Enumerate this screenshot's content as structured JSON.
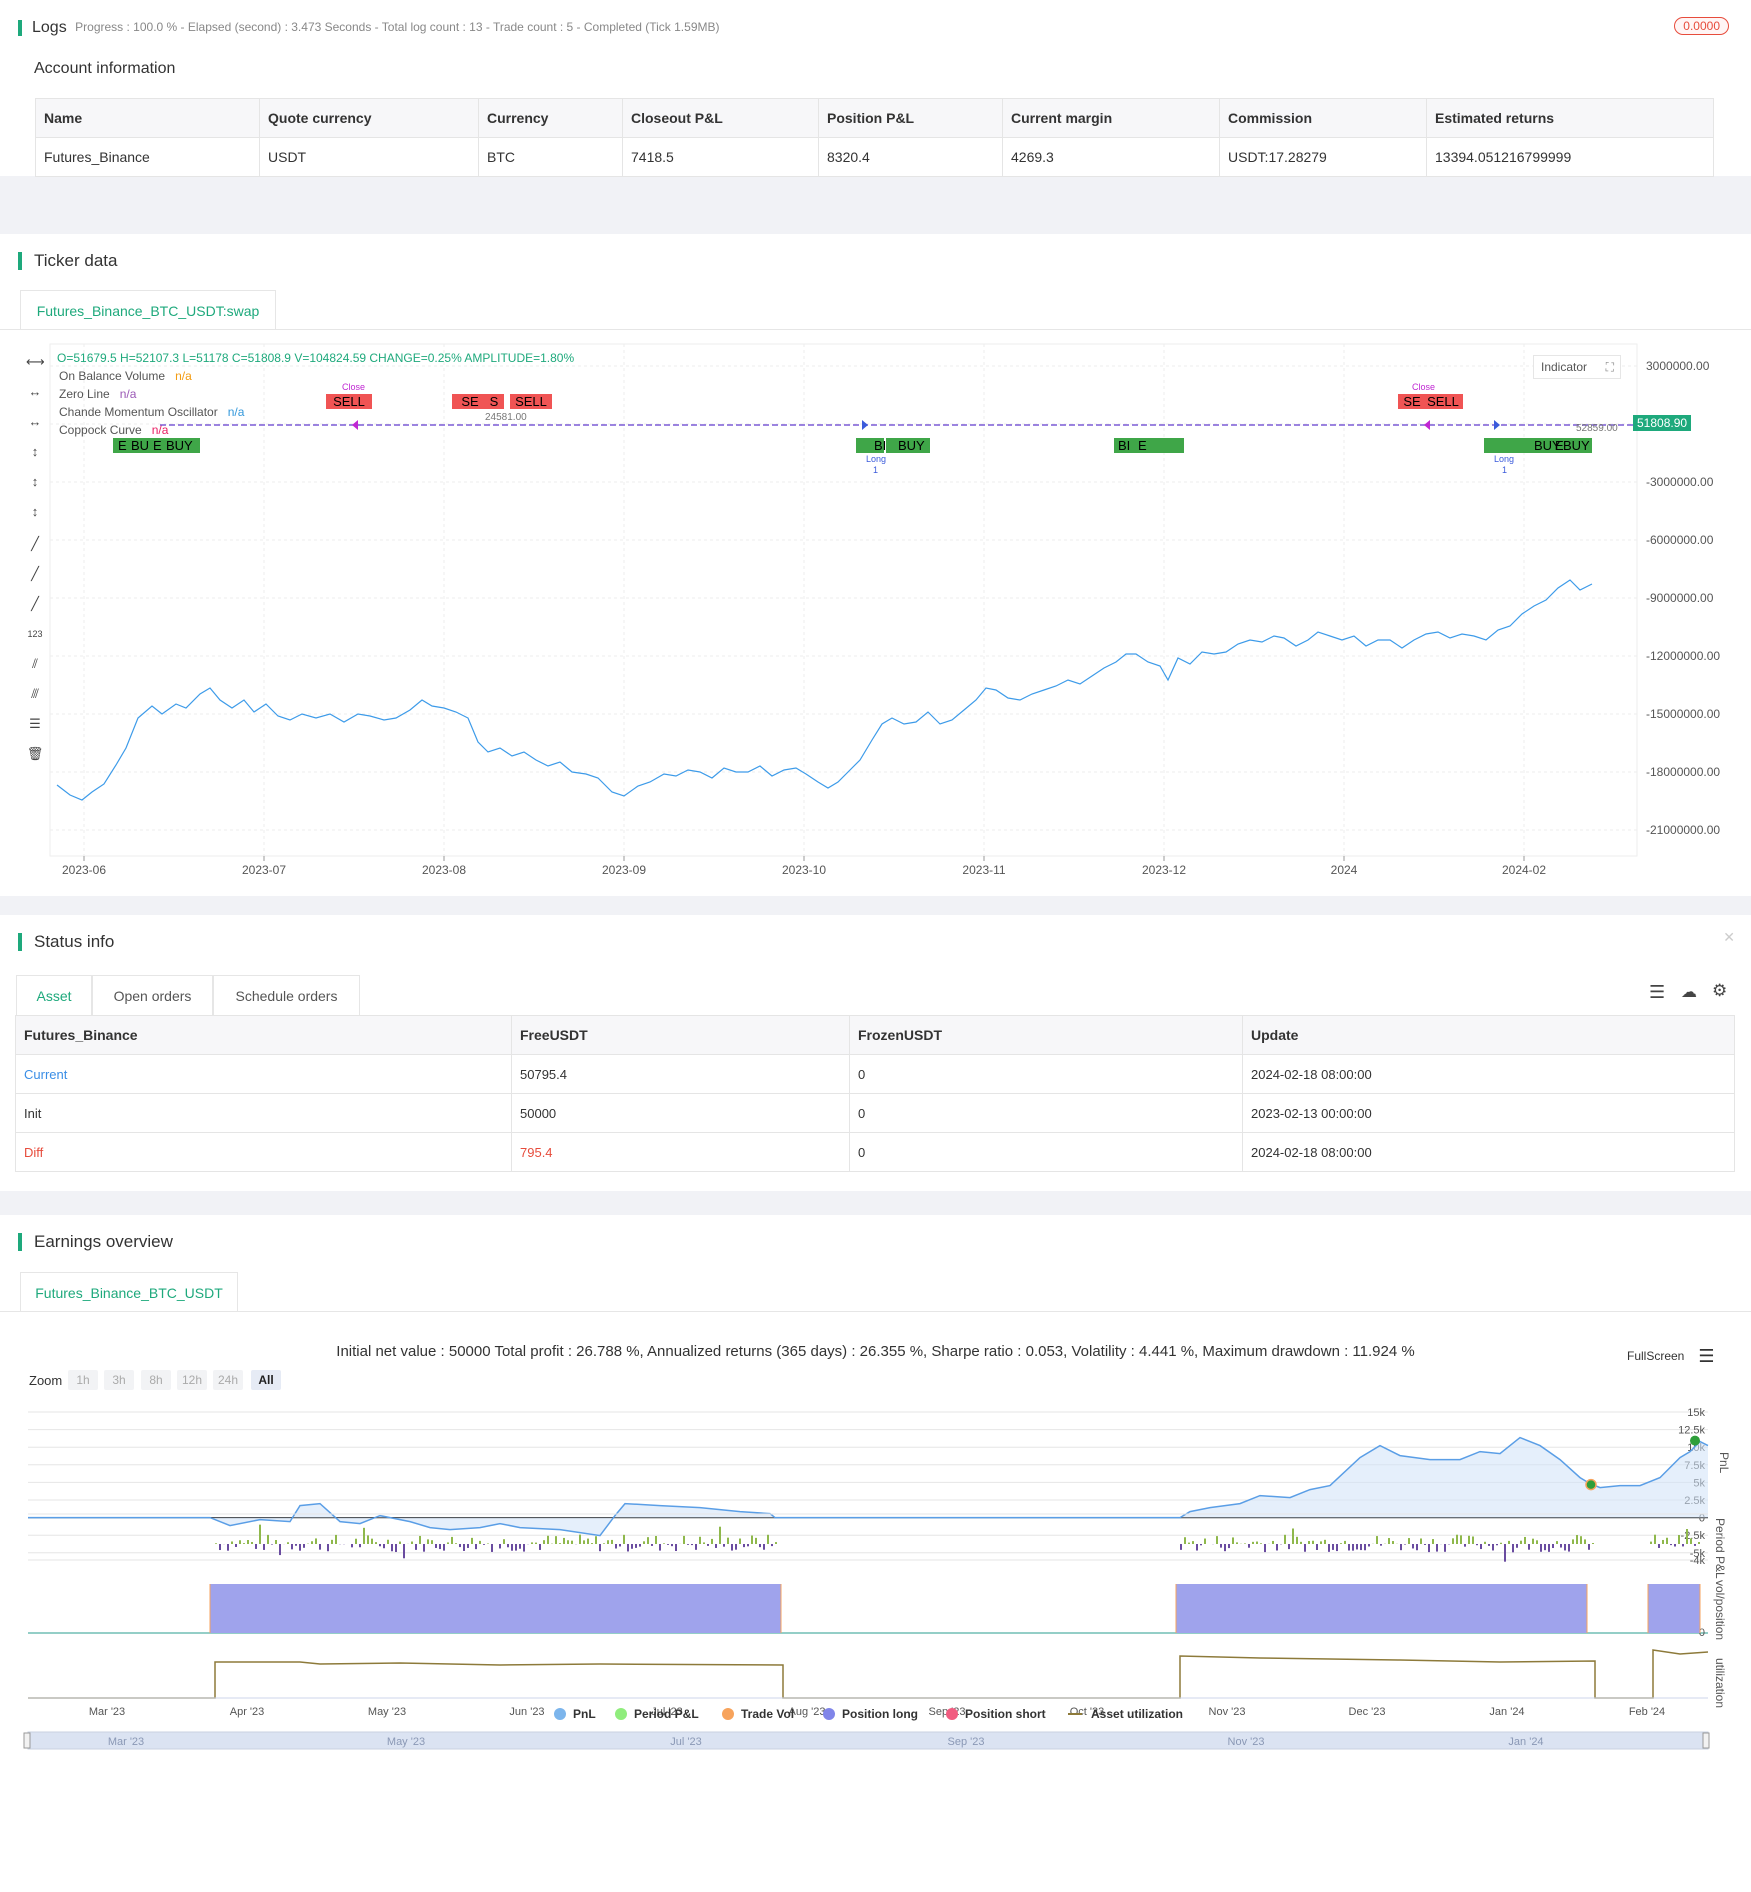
{
  "logs": {
    "title": "Logs",
    "status_line": "Progress : 100.0 % - Elapsed (second) : 3.473  Seconds - Total log count : 13 - Trade count : 5 - Completed (Tick 1.59MB)",
    "badge": "0.0000"
  },
  "account": {
    "title": "Account information",
    "headers": [
      "Name",
      "Quote currency",
      "Currency",
      "Closeout P&L",
      "Position P&L",
      "Current margin",
      "Commission",
      "Estimated returns"
    ],
    "row": [
      "Futures_Binance",
      "USDT",
      "BTC",
      "7418.5",
      "8320.4",
      "4269.3",
      "USDT:17.28279",
      "13394.051216799999"
    ]
  },
  "ticker": {
    "title": "Ticker data",
    "tab": "Futures_Binance_BTC_USDT:swap",
    "ohlc": "O=51679.5 H=52107.3 L=51178 C=51808.9 V=104824.59 CHANGE=0.25% AMPLITUDE=1.80%",
    "indicator_button": "Indicator",
    "legend": [
      {
        "name": "On Balance Volume",
        "value": "n/a",
        "color": "#f39c12"
      },
      {
        "name": "Zero Line",
        "value": "n/a",
        "color": "#9b59b6"
      },
      {
        "name": "Chande Momentum Oscillator",
        "value": "n/a",
        "color": "#3498db"
      },
      {
        "name": "Coppock Curve",
        "value": "n/a",
        "color": "#e91e63"
      }
    ],
    "price_tag": "51808.90",
    "y_ticks": [
      "3000000.00",
      "0.00",
      "-3000000.00",
      "-6000000.00",
      "-9000000.00",
      "-12000000.00",
      "-15000000.00",
      "-18000000.00",
      "-21000000.00"
    ],
    "x_ticks": [
      "2023-06",
      "2023-07",
      "2023-08",
      "2023-09",
      "2023-10",
      "2023-11",
      "2023-12",
      "2024",
      "2024-02"
    ],
    "annotations": [
      "24581.00",
      "52859.00"
    ],
    "sell_labels": [
      "SELL",
      "SE",
      "S",
      "SELL",
      "SE",
      "SELL"
    ],
    "buy_labels": [
      "E",
      "BU",
      "E",
      "BUY",
      "BI",
      "BUY",
      "BI",
      "E",
      "BUY",
      "E",
      "BUY"
    ],
    "close_labels": [
      "Close",
      "Close"
    ],
    "long_labels": [
      "Long",
      "Long"
    ],
    "long_counts": [
      "1",
      "1"
    ]
  },
  "status": {
    "title": "Status info",
    "tabs": [
      "Asset",
      "Open orders",
      "Schedule orders"
    ],
    "headers": [
      "Futures_Binance",
      "FreeUSDT",
      "FrozenUSDT",
      "Update"
    ],
    "rows": [
      [
        "Current",
        "50795.4",
        "0",
        "2024-02-18 08:00:00"
      ],
      [
        "Init",
        "50000",
        "0",
        "2023-02-13 00:00:00"
      ],
      [
        "Diff",
        "795.4",
        "0",
        "2024-02-18 08:00:00"
      ]
    ]
  },
  "earnings": {
    "title": "Earnings overview",
    "tab": "Futures_Binance_BTC_USDT",
    "summary": "Initial net value : 50000 Total profit : 26.788 %, Annualized returns (365 days) : 26.355 %, Sharpe ratio : 0.053, Volatility : 4.441 %, Maximum drawdown : 11.924 %",
    "fullscreen": "FullScreen",
    "zoom_label": "Zoom",
    "zoom_buttons": [
      "1h",
      "3h",
      "8h",
      "12h",
      "24h",
      "All"
    ],
    "pnl_ticks": [
      "15k",
      "12.5k",
      "10k",
      "7.5k",
      "5k",
      "2.5k",
      "0",
      "-2.5k",
      "-5k"
    ],
    "pnl_axis": "PnL",
    "period_axis": "Period P&L",
    "period_tick": "-4k",
    "pos_axis": "vol/position",
    "pos_tick": "0",
    "util_axis": "utilization",
    "x_ticks": [
      "Mar '23",
      "Apr '23",
      "May '23",
      "Jun '23",
      "Jul '23",
      "Aug '23",
      "Sep '23",
      "Oct '23",
      "Nov '23",
      "Dec '23",
      "Jan '24",
      "Feb '24"
    ],
    "nav_ticks": [
      "Mar '23",
      "May '23",
      "Jul '23",
      "Sep '23",
      "Nov '23",
      "Jan '24"
    ],
    "legend": [
      {
        "name": "PnL",
        "color": "#7cb5ec"
      },
      {
        "name": "Period P&L",
        "color": "#90ed7d"
      },
      {
        "name": "Trade Vol",
        "color": "#f7a35c"
      },
      {
        "name": "Position long",
        "color": "#8085e9"
      },
      {
        "name": "Position short",
        "color": "#f15c80"
      },
      {
        "name": "Asset utilization",
        "color": "#8d7a3a"
      }
    ]
  }
}
